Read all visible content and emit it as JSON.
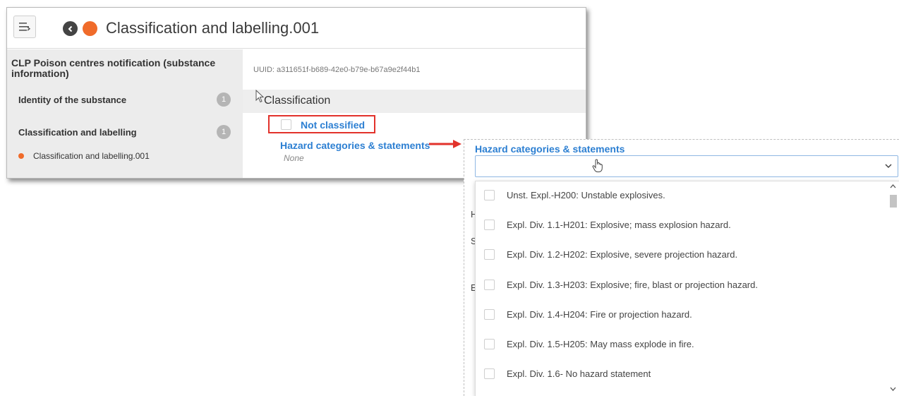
{
  "colors": {
    "accent": "#2c7fd2",
    "status_dot": "#f06b2a",
    "highlight_border": "#e2322b"
  },
  "icons": {
    "menu": "menu-collapse-icon",
    "back": "chevron-left-circle-icon",
    "status": "status-dot-icon",
    "dropdown": "chevron-down-icon",
    "pointer": "hand-pointer-icon"
  },
  "header": {
    "title": "Classification and labelling.001"
  },
  "sidebar": {
    "heading": "CLP Poison centres notification (substance information)",
    "items": [
      {
        "label": "Identity of the substance",
        "count": "1"
      },
      {
        "label": "Classification and labelling",
        "count": "1"
      }
    ],
    "sub_item": "Classification and labelling.001"
  },
  "content": {
    "uuid": "UUID: a311651f-b689-42e0-b79e-b67a9e2f44b1",
    "section_title": "Classification",
    "not_classified": "Not classified",
    "hazard_link": "Hazard categories & statements",
    "hazard_value": "None"
  },
  "dropdown": {
    "label": "Hazard categories & statements",
    "hints": [
      "H",
      "S",
      "E"
    ],
    "options": [
      "Unst. Expl.-H200: Unstable explosives.",
      "Expl. Div. 1.1-H201: Explosive; mass explosion hazard.",
      "Expl. Div. 1.2-H202: Explosive, severe projection hazard.",
      "Expl. Div. 1.3-H203: Explosive; fire, blast or projection hazard.",
      "Expl. Div. 1.4-H204: Fire or projection hazard.",
      "Expl. Div. 1.5-H205: May mass explode in fire.",
      "Expl. Div. 1.6- No hazard statement"
    ]
  }
}
